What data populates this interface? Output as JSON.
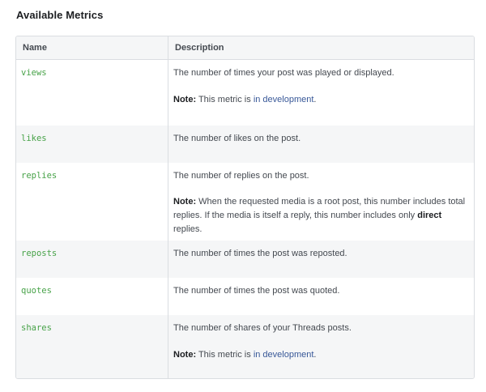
{
  "section": {
    "title": "Available Metrics"
  },
  "table": {
    "headers": {
      "name": "Name",
      "description": "Description"
    },
    "rows": [
      {
        "name": "views",
        "description": "The number of times your post was played or displayed.",
        "note_label": "Note:",
        "note_text": " This metric is ",
        "note_link": "in development",
        "note_end": "."
      },
      {
        "name": "likes",
        "description": "The number of likes on the post."
      },
      {
        "name": "replies",
        "description": "The number of replies on the post.",
        "note_label": "Note:",
        "note_text": " When the requested media is a root post, this number includes total replies. If the media is itself a reply, this number includes only ",
        "note_bold": "direct",
        "note_end": " replies."
      },
      {
        "name": "reposts",
        "description": "The number of times the post was reposted."
      },
      {
        "name": "quotes",
        "description": "The number of times the post was quoted."
      },
      {
        "name": "shares",
        "description": "The number of shares of your Threads posts.",
        "note_label": "Note:",
        "note_text": " This metric is ",
        "note_link": "in development",
        "note_end": "."
      }
    ]
  },
  "colors": {
    "metric_name": "#47a248",
    "link": "#385898",
    "border": "#dadde1",
    "shaded_row": "#f5f6f7"
  }
}
